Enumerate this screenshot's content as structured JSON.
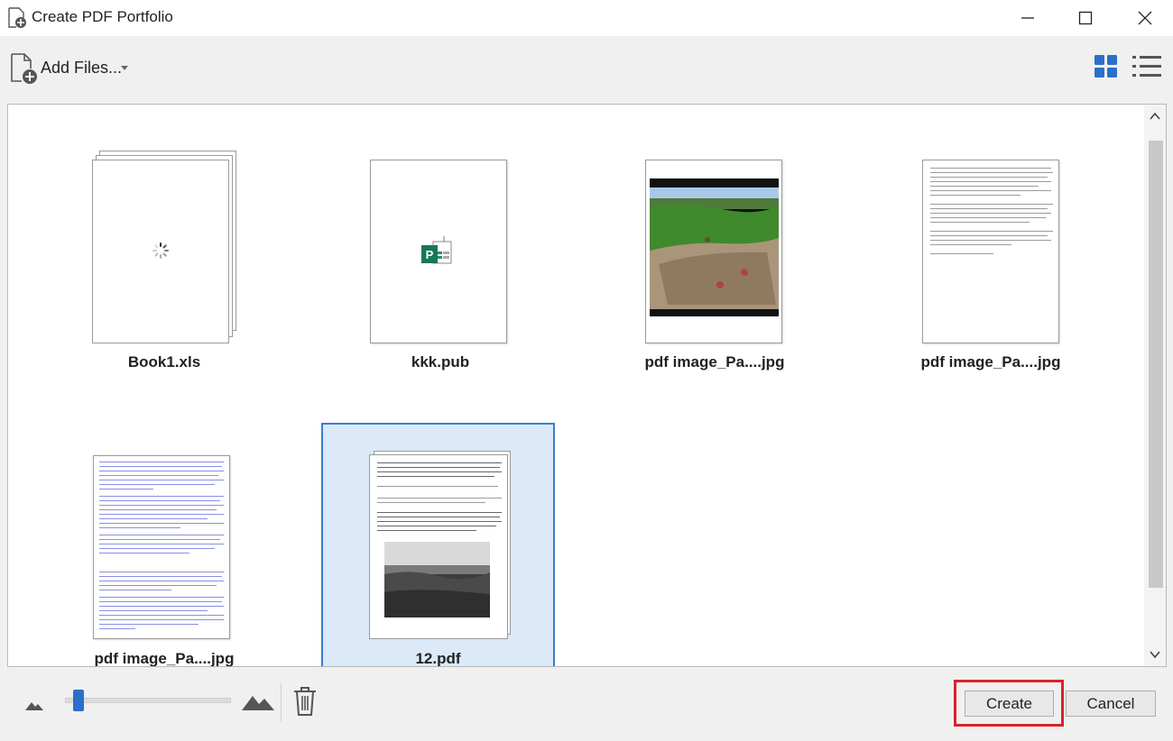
{
  "window": {
    "title": "Create PDF Portfolio"
  },
  "toolbar": {
    "add_files_label": "Add Files..."
  },
  "files": [
    {
      "name": "Book1.xls",
      "kind": "spreadsheet-loading"
    },
    {
      "name": "kkk.pub",
      "kind": "publisher"
    },
    {
      "name": "pdf image_Pa....jpg",
      "kind": "photo"
    },
    {
      "name": "pdf image_Pa....jpg",
      "kind": "text-document"
    },
    {
      "name": "pdf image_Pa....jpg",
      "kind": "blue-text-document"
    },
    {
      "name": "12.pdf",
      "kind": "pdf",
      "selected": true
    }
  ],
  "thumbnail_size": {
    "level": 0.05
  },
  "buttons": {
    "create": "Create",
    "cancel": "Cancel"
  },
  "colors": {
    "accent": "#2a6fc9",
    "selection": "#dbe9f8",
    "highlight": "#d9242b"
  }
}
